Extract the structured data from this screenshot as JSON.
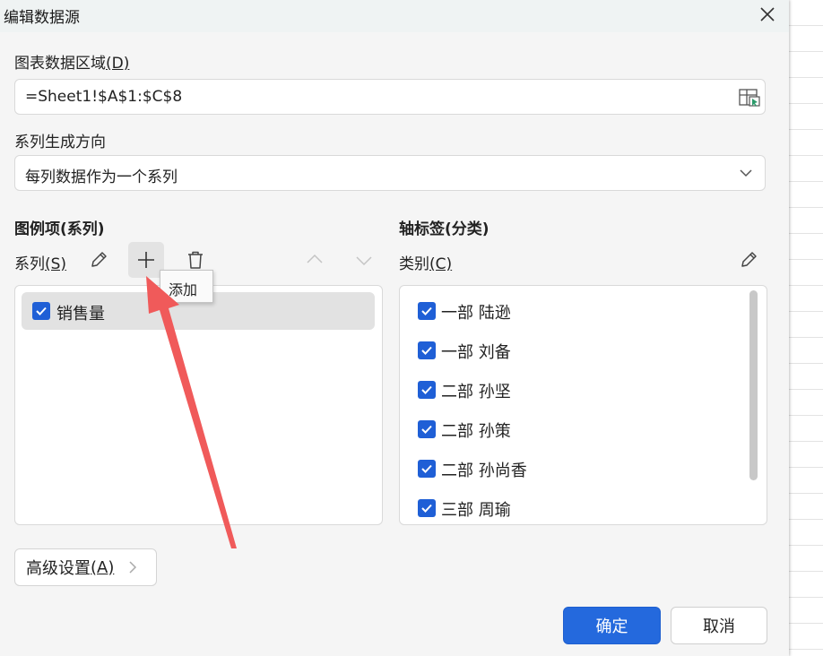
{
  "dialog": {
    "title": "编辑数据源"
  },
  "data_range": {
    "label": "图表数据区域",
    "hotkey": "(D)",
    "value": "=Sheet1!$A$1:$C$8"
  },
  "series_direction": {
    "label": "系列生成方向",
    "selected": "每列数据作为一个系列"
  },
  "legend_section": {
    "title": "图例项(系列)",
    "series_label": "系列",
    "series_hotkey": "(S)",
    "tooltip": "添加",
    "items": [
      {
        "label": "销售量",
        "checked": true
      }
    ]
  },
  "axis_section": {
    "title": "轴标签(分类)",
    "category_label": "类别",
    "category_hotkey": "(C)",
    "items": [
      {
        "label": "一部 陆逊",
        "checked": true
      },
      {
        "label": "一部 刘备",
        "checked": true
      },
      {
        "label": "二部 孙坚",
        "checked": true
      },
      {
        "label": "二部 孙策",
        "checked": true
      },
      {
        "label": "二部 孙尚香",
        "checked": true
      },
      {
        "label": "三部 周瑜",
        "checked": true
      }
    ]
  },
  "buttons": {
    "advanced": "高级设置",
    "advanced_hotkey": "(A)",
    "ok": "确定",
    "cancel": "取消"
  },
  "colors": {
    "accent": "#2469dd",
    "checkbox": "#1f5fd6",
    "annotation_arrow": "#f05a5a"
  }
}
